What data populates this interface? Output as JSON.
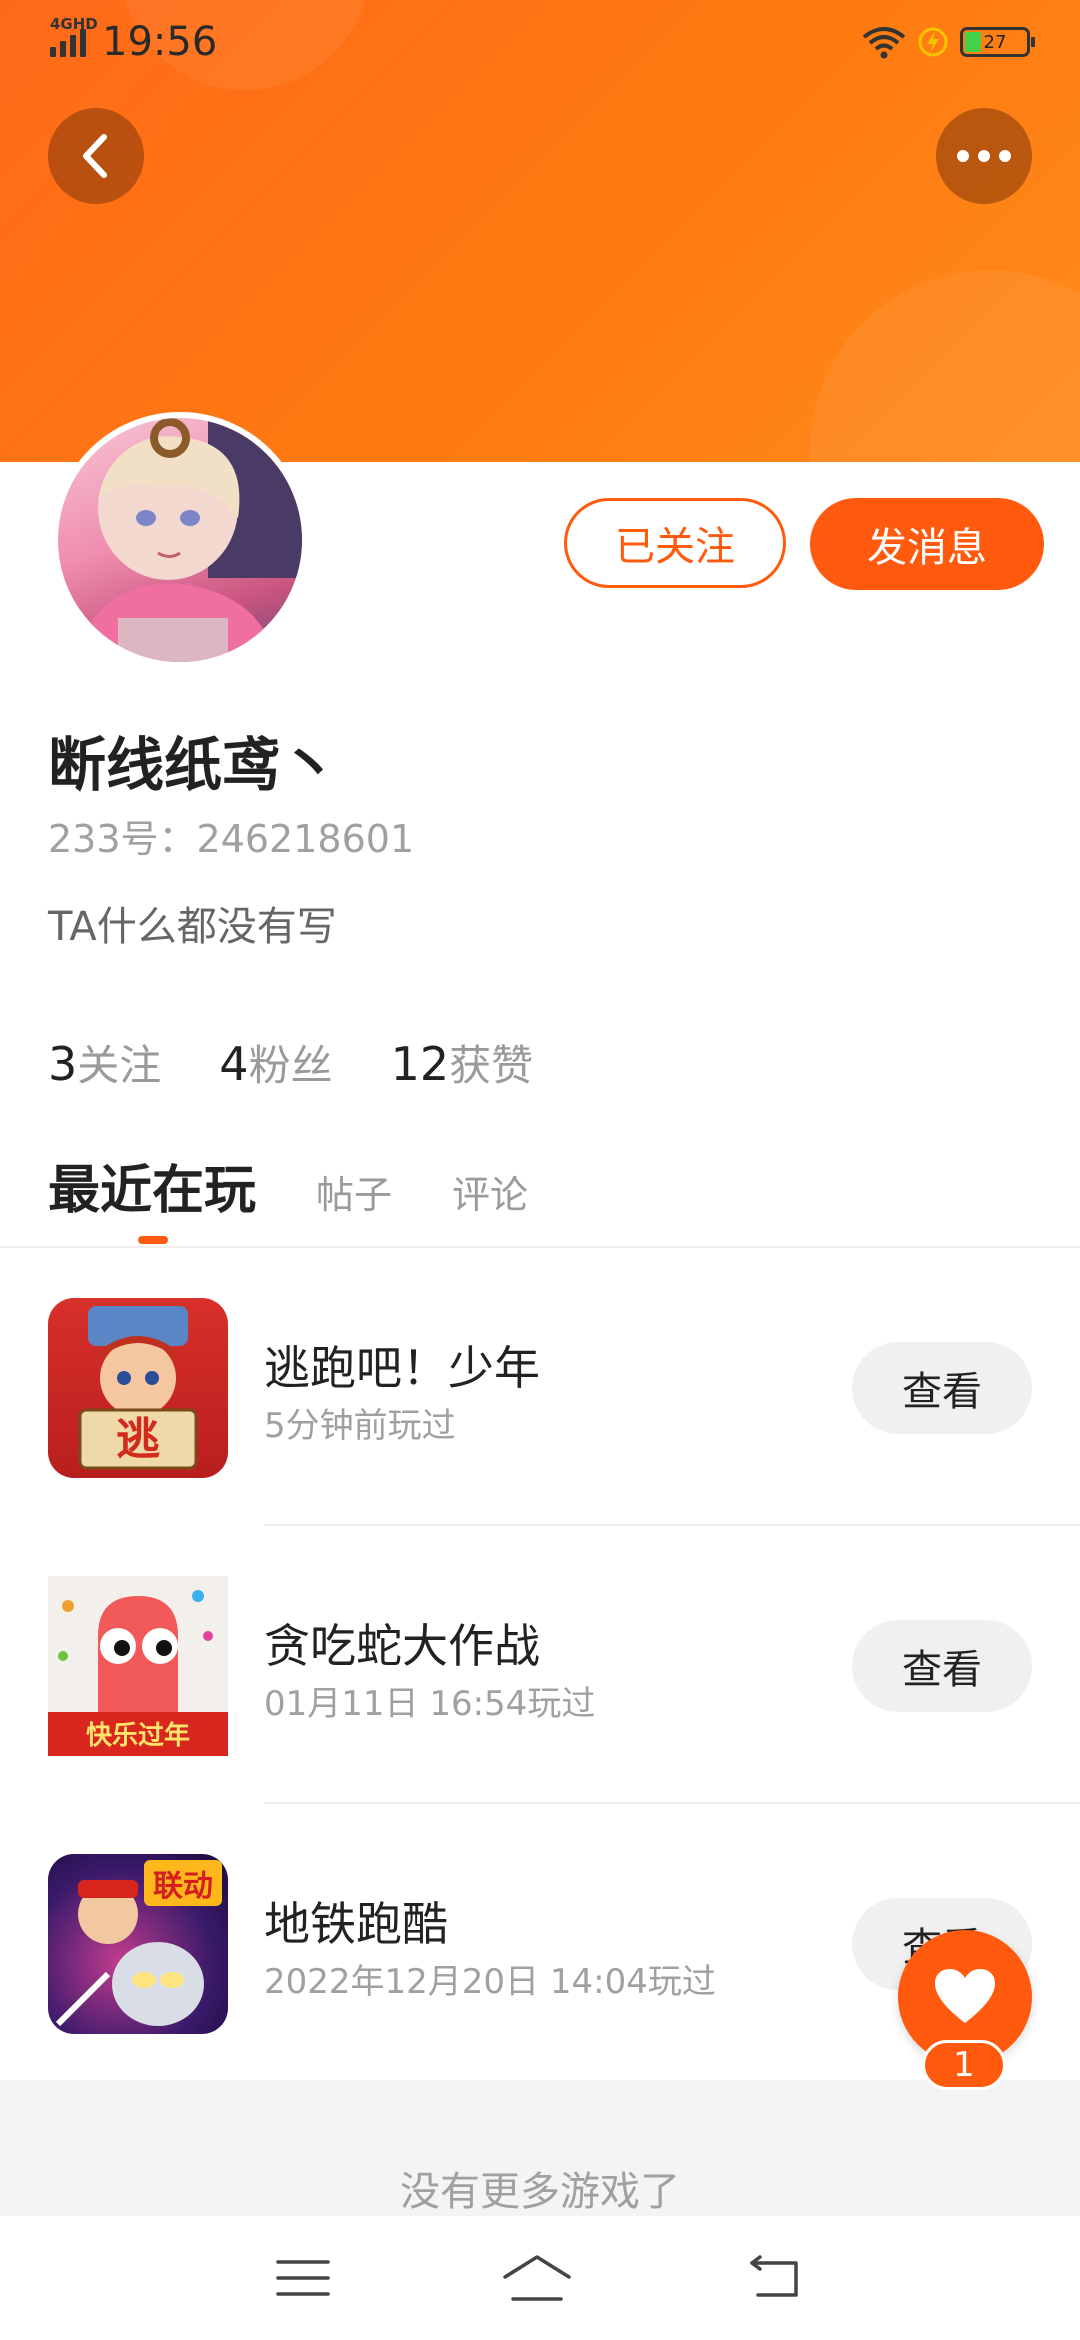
{
  "status_bar": {
    "network": "4GHD",
    "time": "19:56",
    "battery": "27"
  },
  "profile": {
    "followed_label": "已关注",
    "message_label": "发消息",
    "username": "断线纸鸢丶",
    "id_text": "233号：246218601",
    "bio": "TA什么都没有写",
    "stats": [
      {
        "num": "3",
        "label": "关注"
      },
      {
        "num": "4",
        "label": "粉丝"
      },
      {
        "num": "12",
        "label": "获赞"
      }
    ]
  },
  "tabs": [
    {
      "label": "最近在玩",
      "active": true
    },
    {
      "label": "帖子",
      "active": false
    },
    {
      "label": "评论",
      "active": false
    }
  ],
  "games": [
    {
      "name": "逃跑吧！少年",
      "time": "5分钟前玩过",
      "action": "查看",
      "icon": "escape-game-icon",
      "icon_text": "逃"
    },
    {
      "name": "贪吃蛇大作战",
      "time": "01月11日 16:54玩过",
      "action": "查看",
      "icon": "snake-game-icon",
      "icon_text": "快乐过年"
    },
    {
      "name": "地铁跑酷",
      "time": "2022年12月20日 14:04玩过",
      "action": "查看",
      "icon": "subway-game-icon",
      "icon_text": "联动"
    }
  ],
  "footer": {
    "no_more_text": "没有更多游戏了"
  },
  "like": {
    "count": "1"
  },
  "colors": {
    "accent": "#ff5a0d",
    "header": "#ff7a10"
  }
}
